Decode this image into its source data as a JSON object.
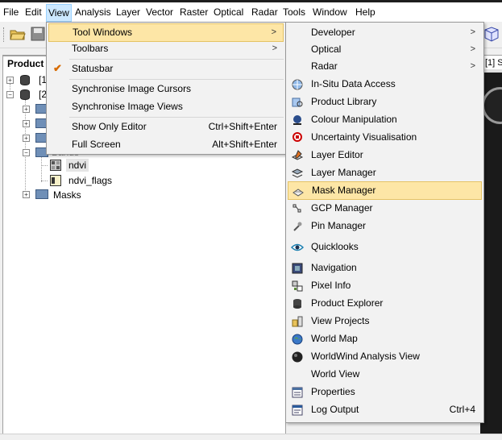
{
  "menubar": {
    "items": [
      "File",
      "Edit",
      "View",
      "Analysis",
      "Layer",
      "Vector",
      "Raster",
      "Optical",
      "Radar",
      "Tools",
      "Window",
      "Help"
    ]
  },
  "panel": {
    "title": "Product E",
    "tree": [
      {
        "label": "[1"
      },
      {
        "label": "[2"
      },
      {
        "label": ""
      },
      {
        "label": ""
      },
      {
        "label": ""
      },
      {
        "label": "Bands"
      },
      {
        "label": "ndvi"
      },
      {
        "label": "ndvi_flags"
      },
      {
        "label": "Masks"
      }
    ]
  },
  "right_panel": {
    "tab": "[1] S"
  },
  "view_menu": {
    "items": [
      {
        "label": "Tool Windows",
        "shortcut": "",
        "submenu": true
      },
      {
        "label": "Toolbars",
        "shortcut": "",
        "submenu": true
      },
      {
        "label": "Statusbar",
        "shortcut": "",
        "checked": true
      },
      {
        "label": "Synchronise Image Cursors",
        "shortcut": ""
      },
      {
        "label": "Synchronise Image Views",
        "shortcut": ""
      },
      {
        "label": "Show Only Editor",
        "shortcut": "Ctrl+Shift+Enter"
      },
      {
        "label": "Full Screen",
        "shortcut": "Alt+Shift+Enter"
      }
    ],
    "arrow": ">"
  },
  "tool_windows_menu": {
    "items": [
      {
        "label": "Developer",
        "icon": "none",
        "submenu": true
      },
      {
        "label": "Optical",
        "icon": "none",
        "submenu": true
      },
      {
        "label": "Radar",
        "icon": "none",
        "submenu": true
      },
      {
        "label": "In-Situ Data Access",
        "icon": "globe-icon"
      },
      {
        "label": "Product Library",
        "icon": "library-icon"
      },
      {
        "label": "Colour Manipulation",
        "icon": "colour-icon"
      },
      {
        "label": "Uncertainty Visualisation",
        "icon": "uncertainty-icon"
      },
      {
        "label": "Layer Editor",
        "icon": "layer-editor-icon"
      },
      {
        "label": "Layer Manager",
        "icon": "layers-icon"
      },
      {
        "label": "Mask Manager",
        "icon": "mask-icon"
      },
      {
        "label": "GCP Manager",
        "icon": "gcp-icon"
      },
      {
        "label": "Pin Manager",
        "icon": "pin-icon"
      },
      {
        "label": "Quicklooks",
        "icon": "eye-icon"
      },
      {
        "label": "Navigation",
        "icon": "navigation-icon"
      },
      {
        "label": "Pixel Info",
        "icon": "pixel-info-icon"
      },
      {
        "label": "Product Explorer",
        "icon": "database-icon"
      },
      {
        "label": "View Projects",
        "icon": "projects-icon"
      },
      {
        "label": "World Map",
        "icon": "world-map-icon"
      },
      {
        "label": "WorldWind Analysis View",
        "icon": "worldwind-icon"
      },
      {
        "label": "World View",
        "icon": "none"
      },
      {
        "label": "Properties",
        "icon": "properties-icon"
      },
      {
        "label": "Log Output",
        "icon": "log-icon",
        "shortcut": "Ctrl+4"
      }
    ],
    "arrow": ">"
  },
  "colors": {
    "highlight_bg": "#fde6a6",
    "highlight_border": "#e5c365",
    "menu_bg": "#f2f2f2",
    "active_menu_bg": "#cce8ff"
  }
}
